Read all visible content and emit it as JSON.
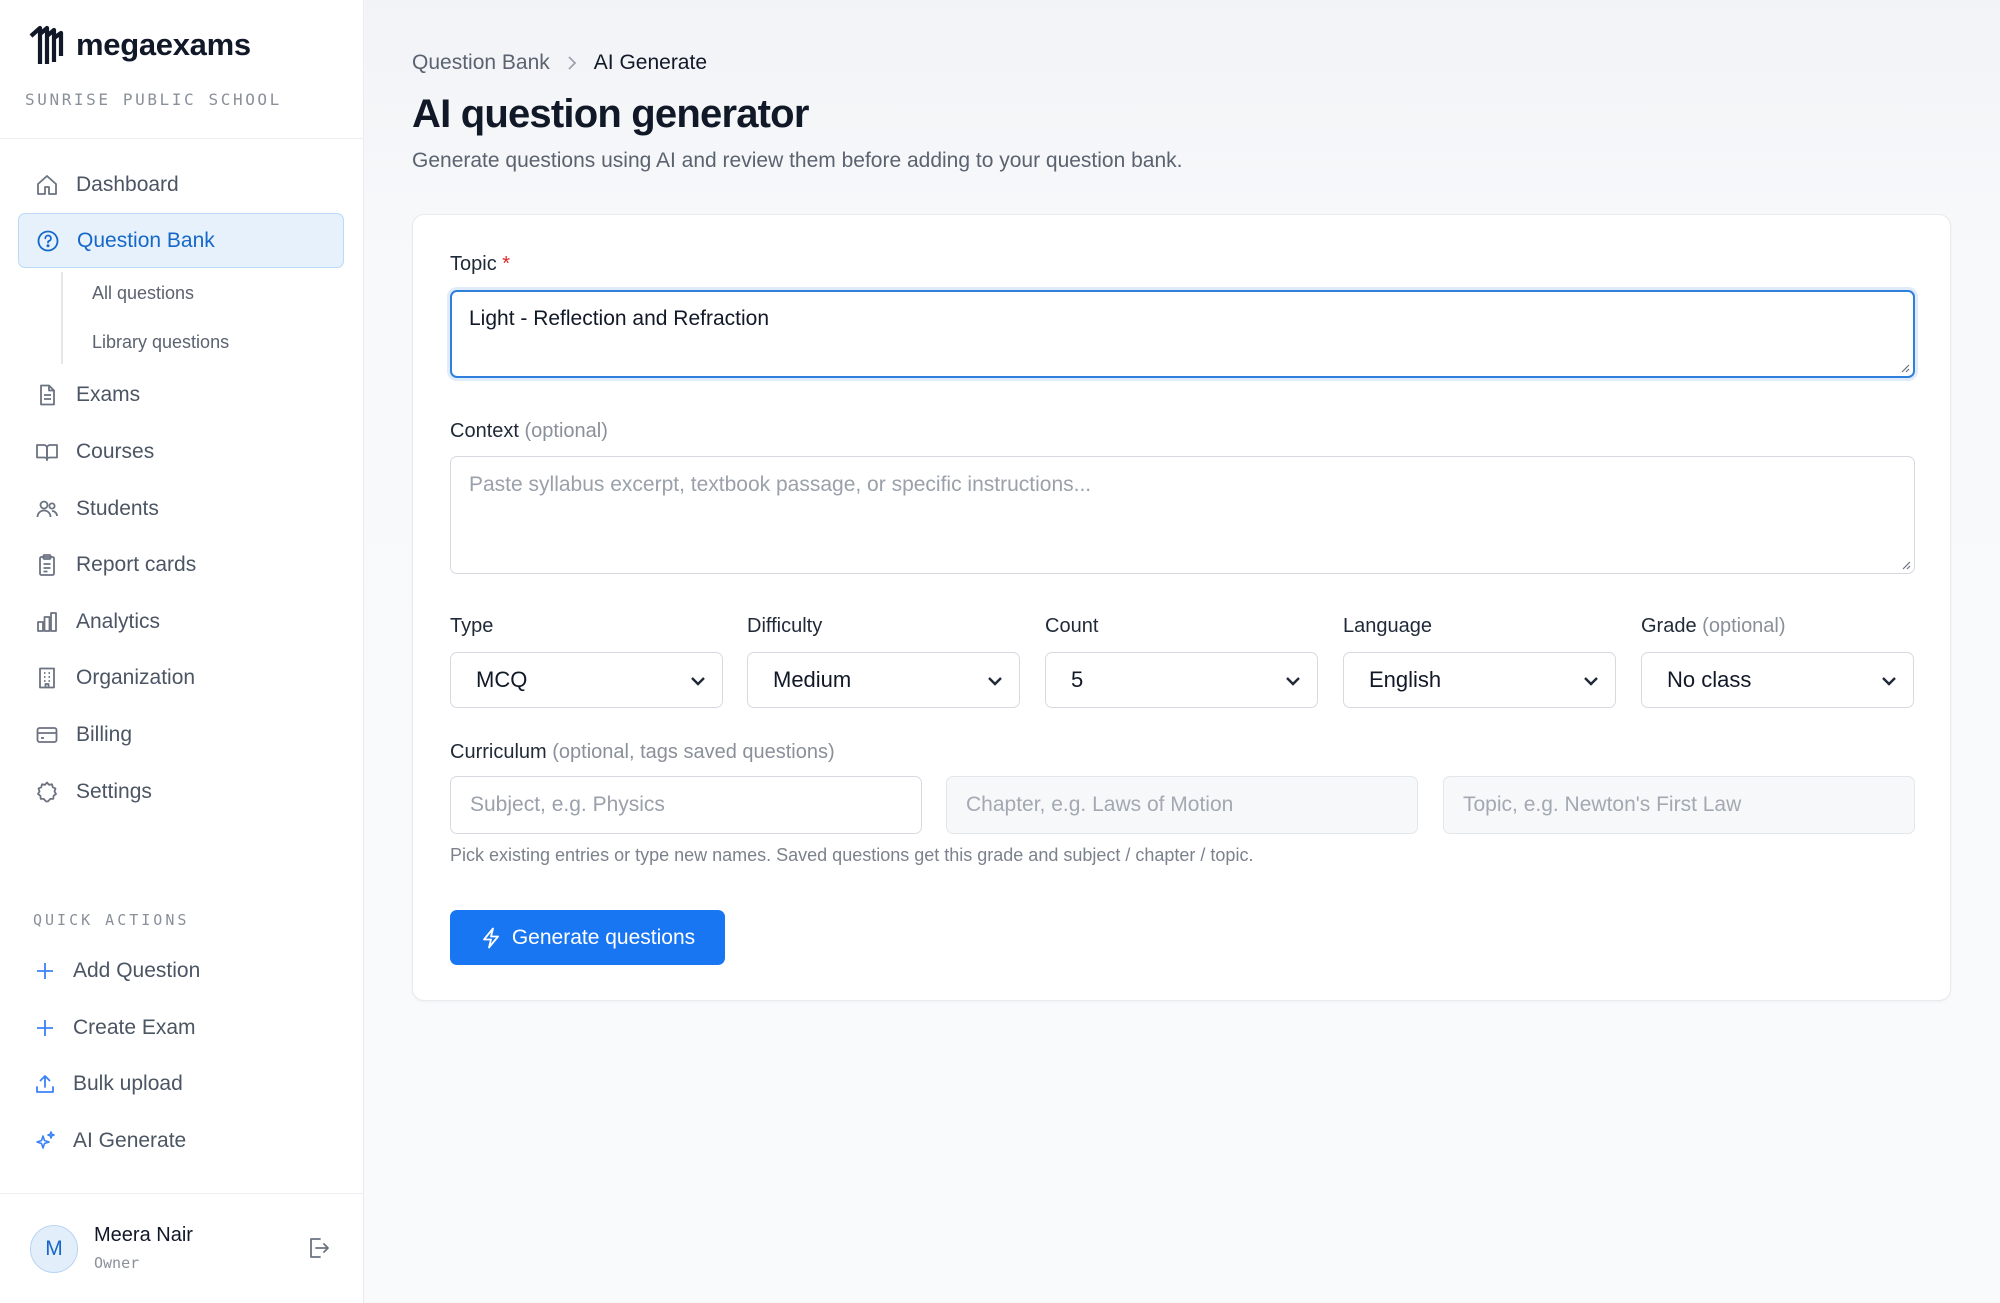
{
  "brand": {
    "name": "megaexams",
    "org": "SUNRISE PUBLIC SCHOOL",
    "logo_icon": "megaexams-logo-icon"
  },
  "sidebar": {
    "items": [
      {
        "label": "Dashboard",
        "icon": "home-icon"
      },
      {
        "label": "Question Bank",
        "icon": "question-circle-icon",
        "active": true
      },
      {
        "label": "Exams",
        "icon": "document-icon"
      },
      {
        "label": "Courses",
        "icon": "book-icon"
      },
      {
        "label": "Students",
        "icon": "users-icon"
      },
      {
        "label": "Report cards",
        "icon": "clipboard-icon"
      },
      {
        "label": "Analytics",
        "icon": "bar-chart-icon"
      },
      {
        "label": "Organization",
        "icon": "building-icon"
      },
      {
        "label": "Billing",
        "icon": "credit-card-icon"
      },
      {
        "label": "Settings",
        "icon": "gear-icon"
      }
    ],
    "sub_items": [
      "All questions",
      "Library questions"
    ],
    "quick_actions_title": "QUICK ACTIONS",
    "quick_actions": [
      {
        "label": "Add Question",
        "icon": "plus-icon"
      },
      {
        "label": "Create Exam",
        "icon": "plus-icon"
      },
      {
        "label": "Bulk upload",
        "icon": "upload-icon"
      },
      {
        "label": "AI Generate",
        "icon": "sparkles-icon"
      }
    ],
    "user": {
      "initial": "M",
      "name": "Meera Nair",
      "role": "Owner"
    }
  },
  "header": {
    "breadcrumb": [
      "Question Bank",
      "AI Generate"
    ],
    "title": "AI question generator",
    "subtitle": "Generate questions using AI and review them before adding to your question bank."
  },
  "form": {
    "topic": {
      "label": "Topic",
      "required_mark": "*",
      "value": "Light - Reflection and Refraction"
    },
    "context": {
      "label": "Context",
      "optional": "(optional)",
      "placeholder": "Paste syllabus excerpt, textbook passage, or specific instructions..."
    },
    "type": {
      "label": "Type",
      "value": "MCQ"
    },
    "difficulty": {
      "label": "Difficulty",
      "value": "Medium"
    },
    "count": {
      "label": "Count",
      "value": "5"
    },
    "language": {
      "label": "Language",
      "value": "English"
    },
    "grade": {
      "label": "Grade",
      "optional": "(optional)",
      "value": "No class"
    },
    "curriculum": {
      "label": "Curriculum",
      "optional": "(optional, tags saved questions)",
      "subject_placeholder": "Subject, e.g. Physics",
      "chapter_placeholder": "Chapter, e.g. Laws of Motion",
      "topic_placeholder": "Topic, e.g. Newton's First Law",
      "hint": "Pick existing entries or type new names. Saved questions get this grade and subject / chapter / topic."
    },
    "generate_label": "Generate questions"
  },
  "colors": {
    "accent": "#1976f2",
    "active_bg": "#e6f1fc",
    "active_text": "#1668c7",
    "required": "#dc2626"
  }
}
